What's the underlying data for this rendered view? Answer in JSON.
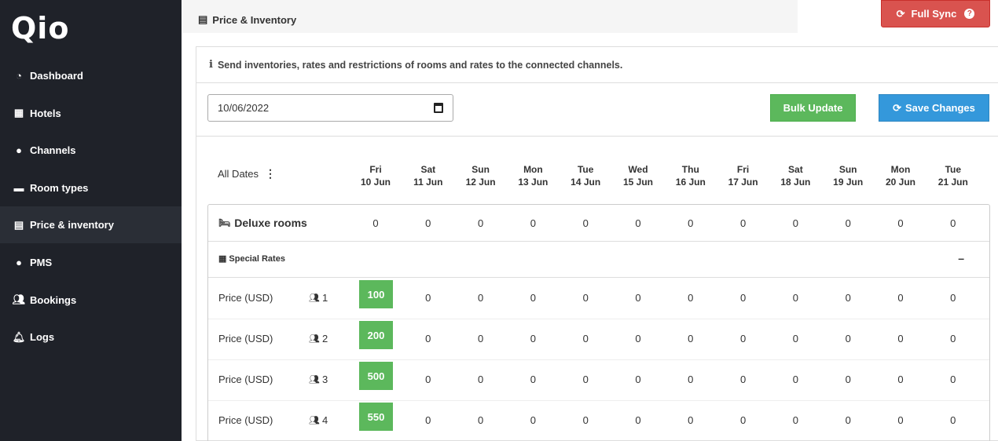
{
  "app": {
    "logo": "Qio"
  },
  "sidebar": {
    "items": [
      {
        "label": "Dashboard",
        "icon": "dashboard-icon"
      },
      {
        "label": "Hotels",
        "icon": "building-icon"
      },
      {
        "label": "Channels",
        "icon": "channels-icon"
      },
      {
        "label": "Room types",
        "icon": "bed-icon"
      },
      {
        "label": "Price & inventory",
        "icon": "clipboard-icon",
        "active": true
      },
      {
        "label": "PMS",
        "icon": "pms-icon"
      },
      {
        "label": "Bookings",
        "icon": "users-icon"
      },
      {
        "label": "Logs",
        "icon": "bell-icon"
      }
    ]
  },
  "header": {
    "title": "Price & Inventory",
    "full_sync_label": "Full Sync"
  },
  "info": {
    "text": "Send inventories, rates and restrictions of rooms and rates to the connected channels."
  },
  "controls": {
    "date_value": "10/06/2022",
    "bulk_update_label": "Bulk Update",
    "save_changes_label": "Save Changes"
  },
  "grid": {
    "all_dates_label": "All Dates",
    "days": [
      {
        "dow": "Fri",
        "date": "10 Jun"
      },
      {
        "dow": "Sat",
        "date": "11 Jun"
      },
      {
        "dow": "Sun",
        "date": "12 Jun"
      },
      {
        "dow": "Mon",
        "date": "13 Jun"
      },
      {
        "dow": "Tue",
        "date": "14 Jun"
      },
      {
        "dow": "Wed",
        "date": "15 Jun"
      },
      {
        "dow": "Thu",
        "date": "16 Jun"
      },
      {
        "dow": "Fri",
        "date": "17 Jun"
      },
      {
        "dow": "Sat",
        "date": "18 Jun"
      },
      {
        "dow": "Sun",
        "date": "19 Jun"
      },
      {
        "dow": "Mon",
        "date": "20 Jun"
      },
      {
        "dow": "Tue",
        "date": "21 Jun"
      }
    ],
    "room": {
      "name": "Deluxe rooms",
      "availability": [
        "0",
        "0",
        "0",
        "0",
        "0",
        "0",
        "0",
        "0",
        "0",
        "0",
        "0",
        "0"
      ]
    },
    "rate_plan": {
      "name": "Special Rates",
      "collapse_symbol": "–"
    },
    "price_rows": [
      {
        "label": "Price (USD)",
        "occupancy": "1",
        "values": [
          "100",
          "0",
          "0",
          "0",
          "0",
          "0",
          "0",
          "0",
          "0",
          "0",
          "0",
          "0"
        ]
      },
      {
        "label": "Price (USD)",
        "occupancy": "2",
        "values": [
          "200",
          "0",
          "0",
          "0",
          "0",
          "0",
          "0",
          "0",
          "0",
          "0",
          "0",
          "0"
        ]
      },
      {
        "label": "Price (USD)",
        "occupancy": "3",
        "values": [
          "500",
          "0",
          "0",
          "0",
          "0",
          "0",
          "0",
          "0",
          "0",
          "0",
          "0",
          "0"
        ]
      },
      {
        "label": "Price (USD)",
        "occupancy": "4",
        "values": [
          "550",
          "0",
          "0",
          "0",
          "0",
          "0",
          "0",
          "0",
          "0",
          "0",
          "0",
          "0"
        ]
      }
    ]
  }
}
